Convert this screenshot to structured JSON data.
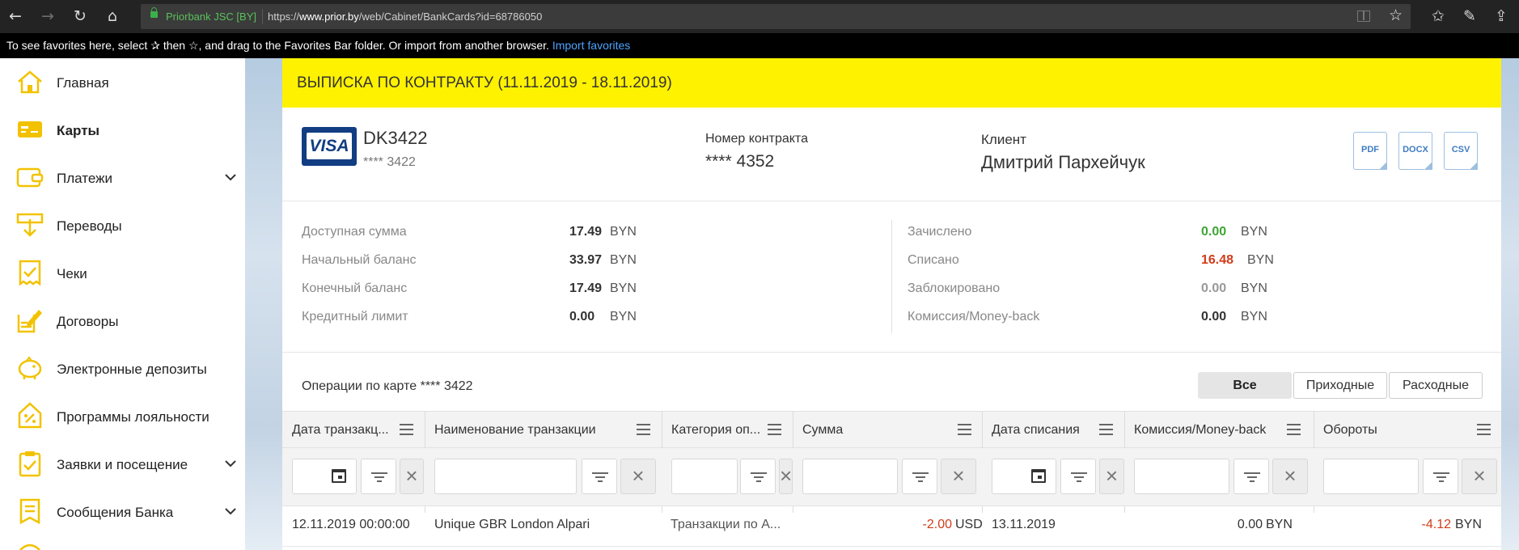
{
  "browser": {
    "site_identity": "Priorbank JSC [BY]",
    "url_prefix": "https://",
    "url_host": "www.prior.by",
    "url_path": "/web/Cabinet/BankCards?id=68786050",
    "favorites_message": "To see favorites here, select ✰ then ☆, and drag to the Favorites Bar folder. Or import from another browser.",
    "import_link": "Import favorites"
  },
  "sidebar": {
    "items": [
      {
        "label": "Главная",
        "icon": "home-icon",
        "has_chevron": false
      },
      {
        "label": "Карты",
        "icon": "card-icon",
        "has_chevron": false,
        "active": true
      },
      {
        "label": "Платежи",
        "icon": "wallet-icon",
        "has_chevron": true
      },
      {
        "label": "Переводы",
        "icon": "transfer-icon",
        "has_chevron": false
      },
      {
        "label": "Чеки",
        "icon": "check-icon",
        "has_chevron": false
      },
      {
        "label": "Договоры",
        "icon": "contract-icon",
        "has_chevron": false
      },
      {
        "label": "Электронные депозиты",
        "icon": "piggy-bank-icon",
        "has_chevron": false
      },
      {
        "label": "Программы лояльности",
        "icon": "percent-tag-icon",
        "has_chevron": false
      },
      {
        "label": "Заявки и посещение",
        "icon": "clipboard-icon",
        "has_chevron": true
      },
      {
        "label": "Сообщения Банка",
        "icon": "message-icon",
        "has_chevron": true
      }
    ],
    "accent_color": "#f2c200"
  },
  "statement": {
    "title": "ВЫПИСКА ПО КОНТРАКТУ (11.11.2019 - 18.11.2019)",
    "header_color": "#fff200",
    "card_brand": "VISA",
    "card_name": "DK3422",
    "card_mask": "**** 3422",
    "contract_label": "Номер контракта",
    "contract_value": "**** 4352",
    "client_label": "Клиент",
    "client_name": "Дмитрий Пархейчук",
    "export_buttons": [
      "PDF",
      "DOCX",
      "CSV"
    ]
  },
  "summary": {
    "left": [
      {
        "label": "Доступная сумма",
        "value": "17.49",
        "currency": "BYN"
      },
      {
        "label": "Начальный баланс",
        "value": "33.97",
        "currency": "BYN"
      },
      {
        "label": "Конечный баланс",
        "value": "17.49",
        "currency": "BYN"
      },
      {
        "label": "Кредитный лимит",
        "value": "0.00",
        "currency": "BYN"
      }
    ],
    "right": [
      {
        "label": "Зачислено",
        "value": "0.00",
        "currency": "BYN",
        "color": "#3fa535"
      },
      {
        "label": "Списано",
        "value": "16.48",
        "currency": "BYN",
        "color": "#d03c1a"
      },
      {
        "label": "Заблокировано",
        "value": "0.00",
        "currency": "BYN",
        "color": "#999999"
      },
      {
        "label": "Комиссия/Money-back",
        "value": "0.00",
        "currency": "BYN",
        "color": "#333333"
      }
    ]
  },
  "operations": {
    "title": "Операции по карте **** 3422",
    "filters": [
      "Все",
      "Приходные",
      "Расходные"
    ],
    "active_filter": "Все",
    "columns": [
      "Дата транзакц...",
      "Наименование транзакции",
      "Категория оп...",
      "Сумма",
      "Дата списания",
      "Комиссия/Money-back",
      "Обороты"
    ],
    "rows": [
      {
        "date": "12.11.2019 00:00:00",
        "name": "Unique GBR London Alpari",
        "category": "Транзакции по А...",
        "amount": "-2.00",
        "amount_currency": "USD",
        "debit_date": "13.11.2019",
        "commission": "0.00",
        "commission_currency": "BYN",
        "turnover": "-4.12",
        "turnover_currency": "BYN"
      }
    ]
  }
}
